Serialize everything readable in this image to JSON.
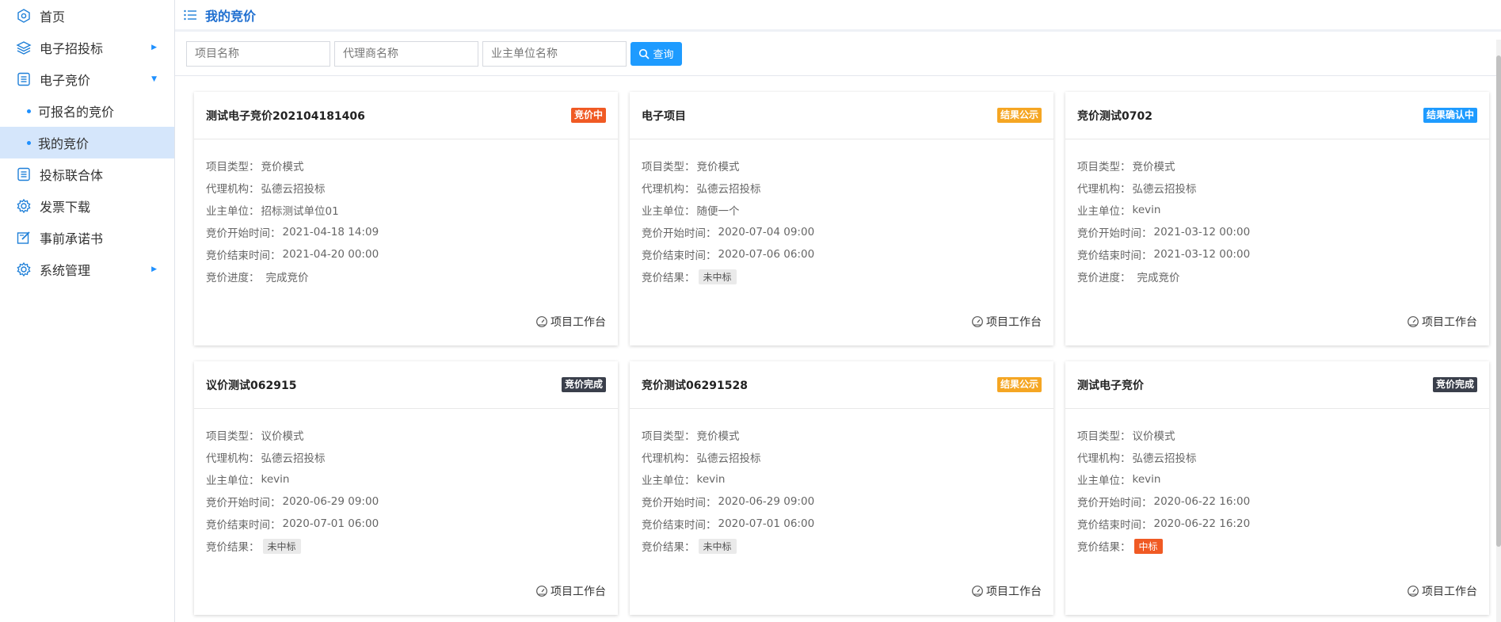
{
  "sidebar": {
    "items": [
      {
        "label": "首页",
        "icon": "home-icon"
      },
      {
        "label": "电子招投标",
        "icon": "layers-icon"
      },
      {
        "label": "电子竞价",
        "icon": "list-icon"
      },
      {
        "label": "可报名的竞价",
        "sub": true
      },
      {
        "label": "我的竞价",
        "sub": true,
        "active": true
      },
      {
        "label": "投标联合体",
        "icon": "list-icon"
      },
      {
        "label": "发票下载",
        "icon": "gear-icon"
      },
      {
        "label": "事前承诺书",
        "icon": "edit-icon"
      },
      {
        "label": "系统管理",
        "icon": "gear-icon"
      }
    ]
  },
  "header": {
    "title": "我的竞价"
  },
  "search": {
    "project_placeholder": "项目名称",
    "agent_placeholder": "代理商名称",
    "owner_placeholder": "业主单位名称",
    "button_label": "查询"
  },
  "workbench_label": "项目工作台",
  "colors": {
    "accent": "#1e9bff",
    "bidding": "#f05a24",
    "publicity": "#f5a623",
    "confirming": "#1e9bff",
    "done": "#3a3f4b"
  },
  "cards": [
    {
      "title": "测试电子竞价202104181406",
      "badge": "竞价中",
      "badge_color": "#f05a24",
      "rows": [
        {
          "label": "项目类型：",
          "value": "竞价模式"
        },
        {
          "label": "代理机构：",
          "value": "弘德云招投标"
        },
        {
          "label": "业主单位：",
          "value": "招标测试单位01"
        },
        {
          "label": "竞价开始时间：",
          "value": "2021-04-18 14:09"
        },
        {
          "label": "竞价结束时间：",
          "value": "2021-04-20 00:00"
        },
        {
          "label": "竞价进度：",
          "value": "完成竞价"
        }
      ]
    },
    {
      "title": "电子项目",
      "badge": "结果公示",
      "badge_color": "#f5a623",
      "rows": [
        {
          "label": "项目类型：",
          "value": "竞价模式"
        },
        {
          "label": "代理机构：",
          "value": "弘德云招投标"
        },
        {
          "label": "业主单位：",
          "value": "随便一个"
        },
        {
          "label": "竞价开始时间：",
          "value": "2020-07-04 09:00"
        },
        {
          "label": "竞价结束时间：",
          "value": "2020-07-06 06:00"
        },
        {
          "label": "竞价结果：",
          "tag": "未中标"
        }
      ]
    },
    {
      "title": "竞价测试0702",
      "badge": "结果确认中",
      "badge_color": "#1e9bff",
      "rows": [
        {
          "label": "项目类型：",
          "value": "竞价模式"
        },
        {
          "label": "代理机构：",
          "value": "弘德云招投标"
        },
        {
          "label": "业主单位：",
          "value": "kevin"
        },
        {
          "label": "竞价开始时间：",
          "value": "2021-03-12 00:00"
        },
        {
          "label": "竞价结束时间：",
          "value": "2021-03-12 00:00"
        },
        {
          "label": "竞价进度：",
          "value": "完成竞价"
        }
      ]
    },
    {
      "title": "议价测试062915",
      "badge": "竞价完成",
      "badge_color": "#3a3f4b",
      "rows": [
        {
          "label": "项目类型：",
          "value": "议价模式"
        },
        {
          "label": "代理机构：",
          "value": "弘德云招投标"
        },
        {
          "label": "业主单位：",
          "value": "kevin"
        },
        {
          "label": "竞价开始时间：",
          "value": "2020-06-29 09:00"
        },
        {
          "label": "竞价结束时间：",
          "value": "2020-07-01 06:00"
        },
        {
          "label": "竞价结果：",
          "tag": "未中标"
        }
      ]
    },
    {
      "title": "竞价测试06291528",
      "badge": "结果公示",
      "badge_color": "#f5a623",
      "rows": [
        {
          "label": "项目类型：",
          "value": "竞价模式"
        },
        {
          "label": "代理机构：",
          "value": "弘德云招投标"
        },
        {
          "label": "业主单位：",
          "value": "kevin"
        },
        {
          "label": "竞价开始时间：",
          "value": "2020-06-29 09:00"
        },
        {
          "label": "竞价结束时间：",
          "value": "2020-07-01 06:00"
        },
        {
          "label": "竞价结果：",
          "tag": "未中标"
        }
      ]
    },
    {
      "title": "测试电子竞价",
      "badge": "竞价完成",
      "badge_color": "#3a3f4b",
      "rows": [
        {
          "label": "项目类型：",
          "value": "议价模式"
        },
        {
          "label": "代理机构：",
          "value": "弘德云招投标"
        },
        {
          "label": "业主单位：",
          "value": "kevin"
        },
        {
          "label": "竞价开始时间：",
          "value": "2020-06-22 16:00"
        },
        {
          "label": "竞价结束时间：",
          "value": "2020-06-22 16:20"
        },
        {
          "label": "竞价结果：",
          "tag": "中标",
          "win": true
        }
      ]
    }
  ]
}
